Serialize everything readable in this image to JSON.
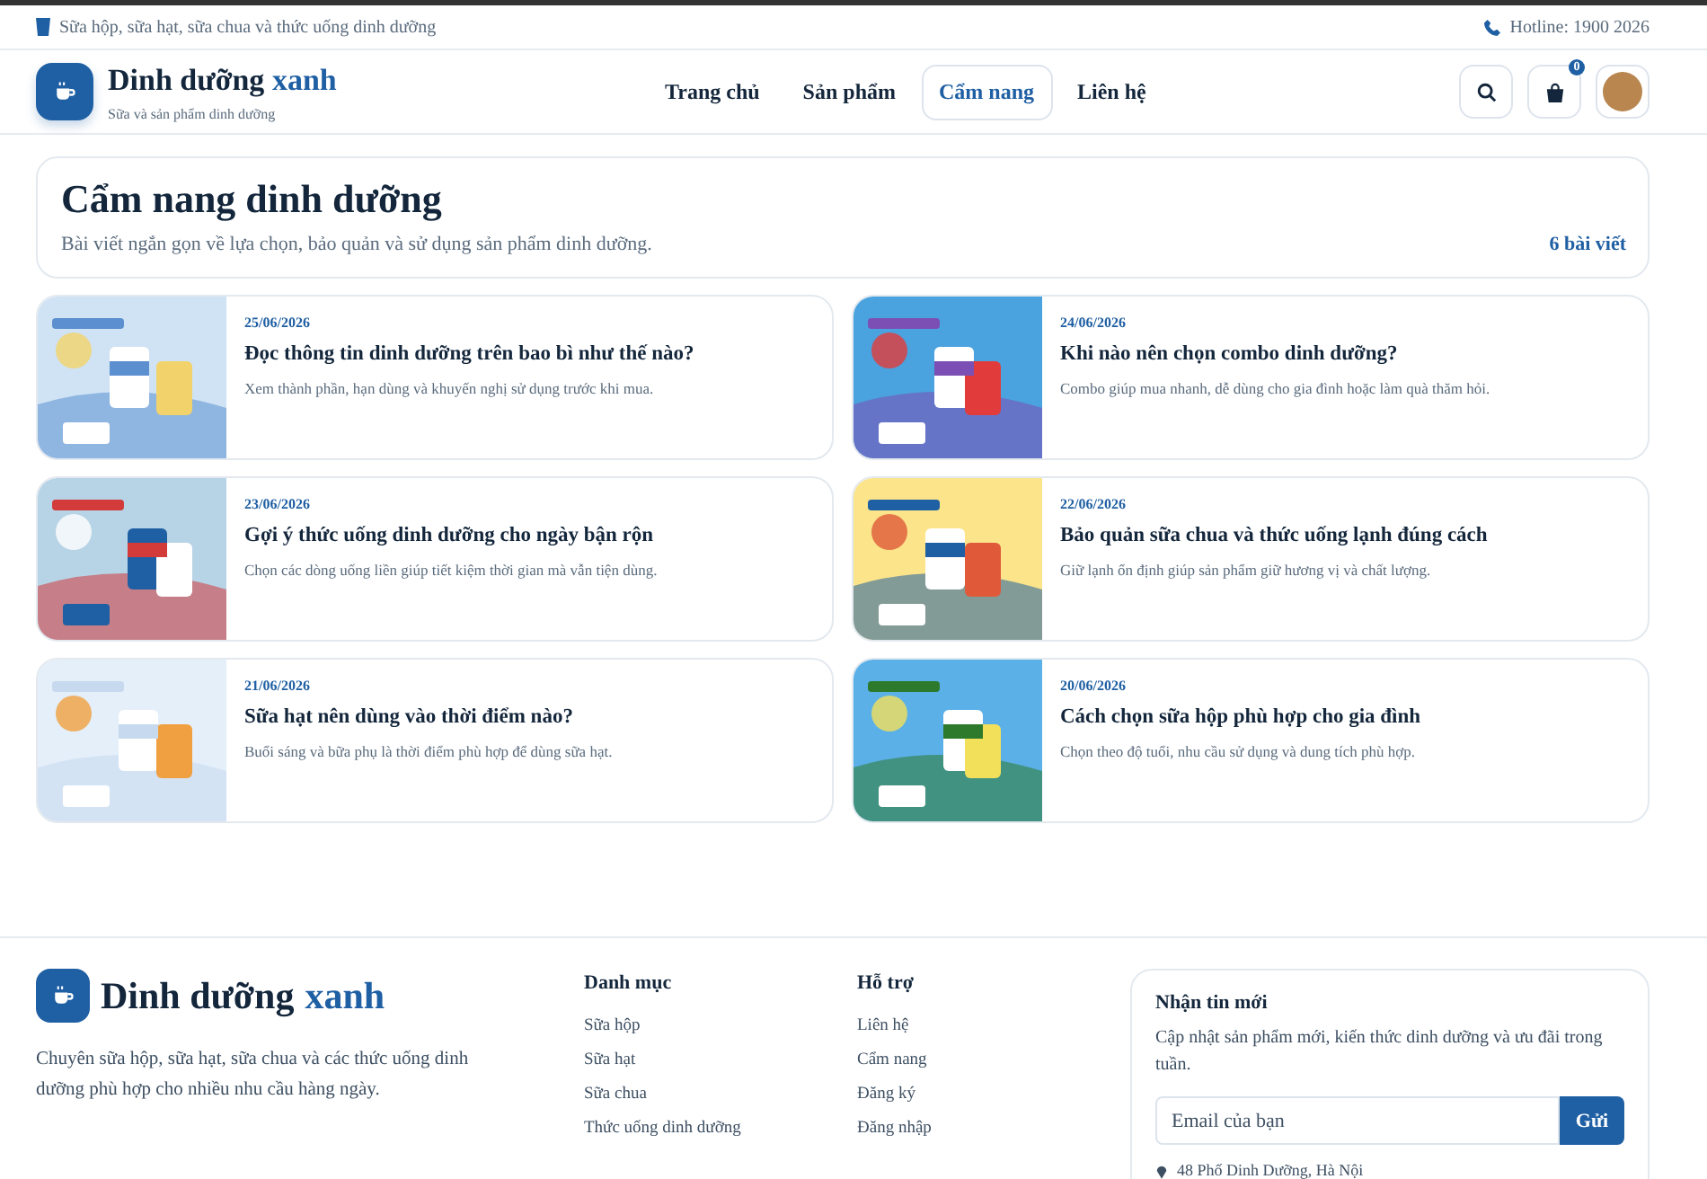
{
  "topbar": {
    "tagline": "Sữa hộp, sữa hạt, sữa chua và thức uống dinh dưỡng",
    "hotline": "Hotline: 1900 2026"
  },
  "header": {
    "brand": "Dinh dưỡng",
    "brand_accent": "xanh",
    "subtitle": "Sữa và sản phẩm dinh dưỡng",
    "nav": [
      {
        "label": "Trang chủ",
        "selected": false
      },
      {
        "label": "Sản phẩm",
        "selected": false
      },
      {
        "label": "Cẩm nang",
        "selected": true
      },
      {
        "label": "Liên hệ",
        "selected": false
      }
    ],
    "cart_count": "0"
  },
  "intro": {
    "title": "Cẩm nang dinh dưỡng",
    "description": "Bài viết ngắn gọn về lựa chọn, bảo quản và sử dụng sản phẩm dinh dưỡng.",
    "count": "6 bài viết"
  },
  "articles": [
    {
      "date": "25/06/2026",
      "title": "Đọc thông tin dinh dưỡng trên bao bì như thế nào?",
      "summary": "Xem thành phần, hạn dùng và khuyến nghị sử dụng trước khi mua."
    },
    {
      "date": "24/06/2026",
      "title": "Khi nào nên chọn combo dinh dưỡng?",
      "summary": "Combo giúp mua nhanh, dễ dùng cho gia đình hoặc làm quà thăm hỏi."
    },
    {
      "date": "23/06/2026",
      "title": "Gợi ý thức uống dinh dưỡng cho ngày bận rộn",
      "summary": "Chọn các dòng uống liền giúp tiết kiệm thời gian mà vẫn tiện dùng."
    },
    {
      "date": "22/06/2026",
      "title": "Bảo quản sữa chua và thức uống lạnh đúng cách",
      "summary": "Giữ lạnh ổn định giúp sản phẩm giữ hương vị và chất lượng."
    },
    {
      "date": "21/06/2026",
      "title": "Sữa hạt nên dùng vào thời điểm nào?",
      "summary": "Buổi sáng và bữa phụ là thời điểm phù hợp để dùng sữa hạt."
    },
    {
      "date": "20/06/2026",
      "title": "Cách chọn sữa hộp phù hợp cho gia đình",
      "summary": "Chọn theo độ tuổi, nhu cầu sử dụng và dung tích phù hợp."
    }
  ],
  "footer": {
    "brand": "Dinh dưỡng",
    "brand_accent": "xanh",
    "about": "Chuyên sữa hộp, sữa hạt, sữa chua và các thức uống dinh dưỡng phù hợp cho nhiều nhu cầu hàng ngày.",
    "columns": [
      {
        "heading": "Danh mục",
        "links": [
          "Sữa hộp",
          "Sữa hạt",
          "Sữa chua",
          "Thức uống dinh dưỡng"
        ]
      },
      {
        "heading": "Hỗ trợ",
        "links": [
          "Liên hệ",
          "Cẩm nang",
          "Đăng ký",
          "Đăng nhập"
        ]
      }
    ],
    "newsletter": {
      "title": "Nhận tin mới",
      "text": "Cập nhật sản phẩm mới, kiến thức dinh dưỡng và ưu đãi trong tuần.",
      "placeholder": "Email của bạn",
      "button": "Gửi",
      "address": "48 Phố Dinh Dưỡng, Hà Nội"
    }
  }
}
